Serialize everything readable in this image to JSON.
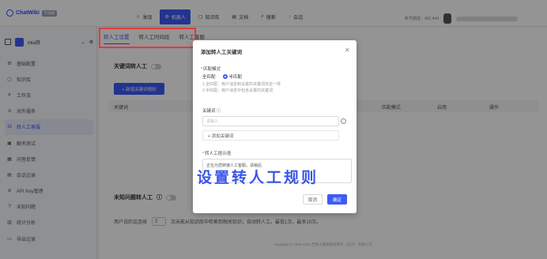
{
  "brand": {
    "name": "ChatWiki",
    "badge": "开源版"
  },
  "top_nav": [
    {
      "label": "发现",
      "icon": "discover-icon"
    },
    {
      "label": "机器人",
      "icon": "robot-icon",
      "active": true
    },
    {
      "label": "知识库",
      "icon": "book-icon"
    },
    {
      "label": "文档",
      "icon": "doc-icon"
    },
    {
      "label": "搜索",
      "icon": "search-icon"
    },
    {
      "label": "会话",
      "icon": "chat-icon"
    }
  ],
  "top_right": {
    "usage_text": "账号额度：481,444"
  },
  "bot_selector": {
    "name": "mia测"
  },
  "sidebar": {
    "items": [
      {
        "label": "基础配置",
        "icon": "settings-icon"
      },
      {
        "label": "知识库",
        "icon": "book-icon"
      },
      {
        "label": "工作流",
        "icon": "workflow-icon"
      },
      {
        "label": "对外服务",
        "icon": "share-icon"
      },
      {
        "label": "转人工客服",
        "icon": "agent-icon",
        "active": true
      },
      {
        "label": "聊天测试",
        "icon": "test-icon"
      },
      {
        "label": "问答反馈",
        "icon": "feedback-icon"
      },
      {
        "label": "会话记录",
        "icon": "history-icon"
      },
      {
        "label": "API Key管理",
        "icon": "key-icon"
      },
      {
        "label": "未知问题",
        "icon": "question-icon"
      },
      {
        "label": "统计分析",
        "icon": "stats-icon"
      },
      {
        "label": "导出记录",
        "icon": "export-icon"
      }
    ]
  },
  "tabs": [
    {
      "label": "转人工设置",
      "active": true
    },
    {
      "label": "转人工时间段"
    },
    {
      "label": "转人工客服"
    }
  ],
  "keyword_section": {
    "title": "关键词转人工",
    "add_button": "+ 新增关键词规则",
    "columns": [
      "关键词",
      "匹配模式",
      "启用",
      "操作"
    ]
  },
  "unknown_section": {
    "title": "未知问题转人工",
    "text_prefix": "用户说的话连续",
    "count_value": "2",
    "text_suffix": "次未能从知识库中检索到相关知识，自动转人工。最低1次，最多10次。"
  },
  "footer": {
    "text": "Copyright © 2016-2024 芝麻小客服版权所有（武汉）有限公司"
  },
  "modal": {
    "title": "添加转人工关键词",
    "match_label": "匹配模式",
    "match_options": [
      "全匹配",
      "半匹配"
    ],
    "match_selected": "半匹配",
    "hint_1": "1.全匹配：用户消息和设置的关键词完全一样",
    "hint_2": "2.半匹配：用户消息中包含设置的关键词",
    "keyword_label": "关键词",
    "keyword_placeholder": "请输入",
    "add_keyword": "+ 添加关键词",
    "prompt_label": "转人工提示语",
    "prompt_value": "正在为您转接人工客服，请稍后",
    "cancel_label": "取消",
    "ok_label": "确定"
  },
  "caption": "设置转人工规则"
}
